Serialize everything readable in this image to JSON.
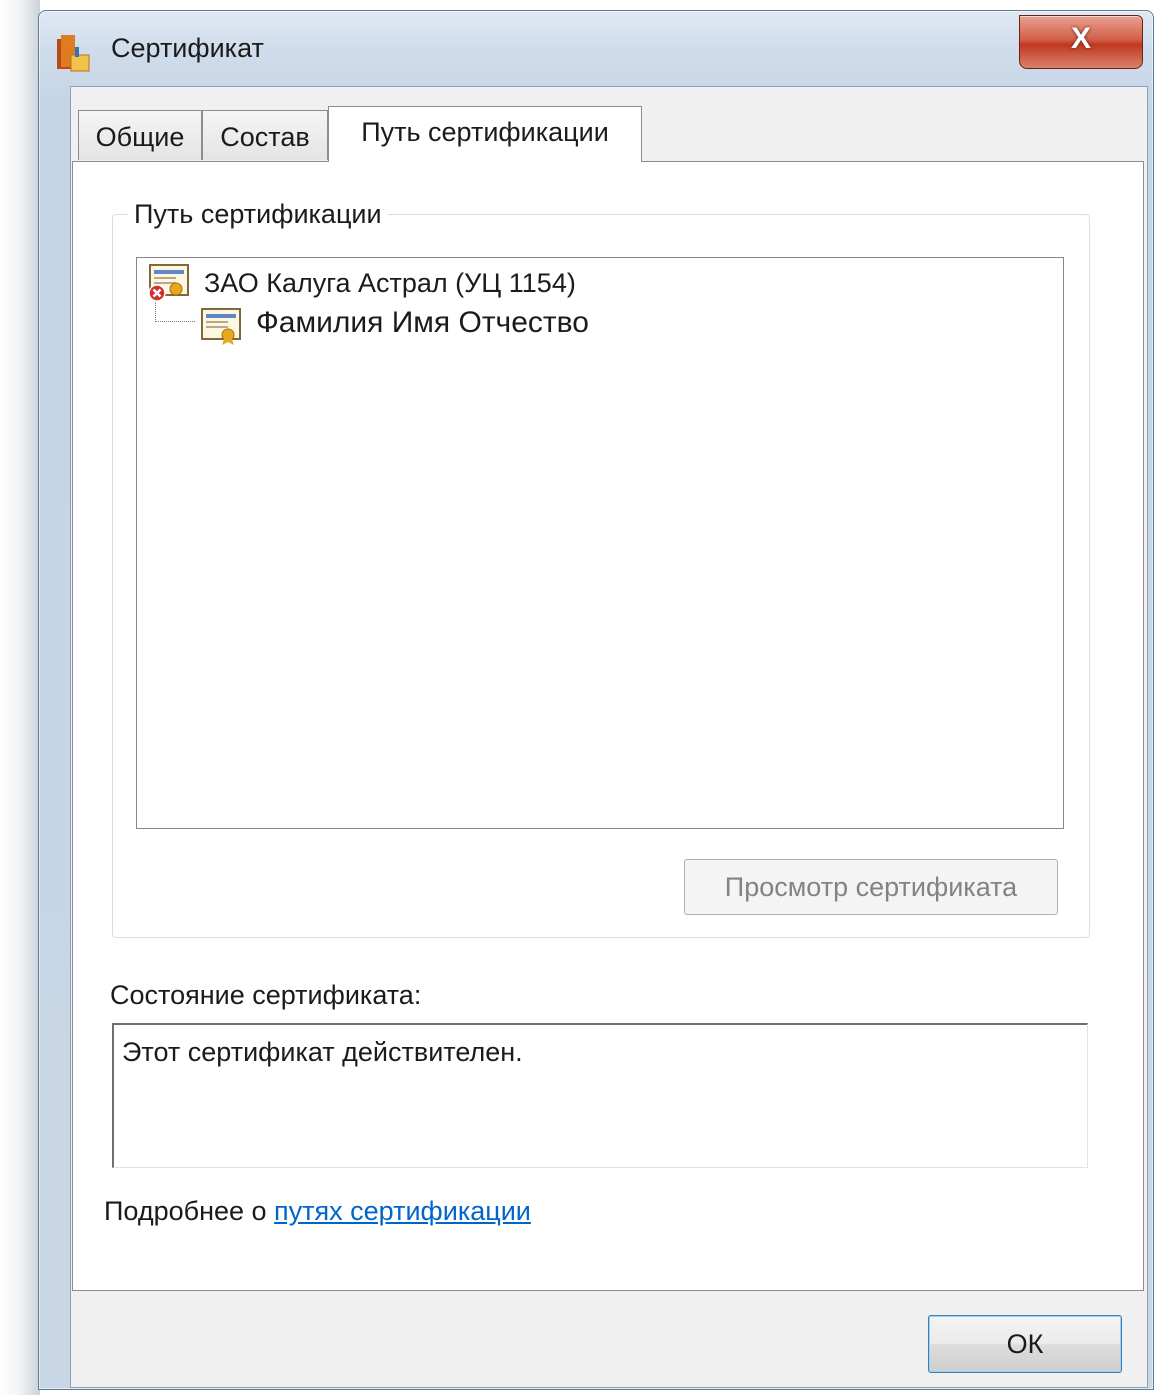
{
  "window": {
    "title": "Сертификат",
    "close_label": "X"
  },
  "tabs": [
    {
      "label": "Общие",
      "active": false
    },
    {
      "label": "Состав",
      "active": false
    },
    {
      "label": "Путь сертификации",
      "active": true
    }
  ],
  "certification_path": {
    "group_label": "Путь сертификации",
    "nodes": [
      {
        "label": "ЗАО Калуга Астрал (УЦ 1154)",
        "status": "error",
        "icon": "certificate-error-icon"
      },
      {
        "label": "Фамилия Имя Отчество",
        "status": "ok",
        "icon": "certificate-icon"
      }
    ],
    "view_button_label": "Просмотр сертификата"
  },
  "status": {
    "label": "Состояние сертификата:",
    "text": "Этот сертификат действителен."
  },
  "more_info": {
    "prefix": "Подробнее о ",
    "link_text": "путях сертификации"
  },
  "ok_label": "ОК",
  "colors": {
    "link": "#0066cc",
    "close_button": "#c0391f",
    "error_badge": "#d32f2f"
  }
}
